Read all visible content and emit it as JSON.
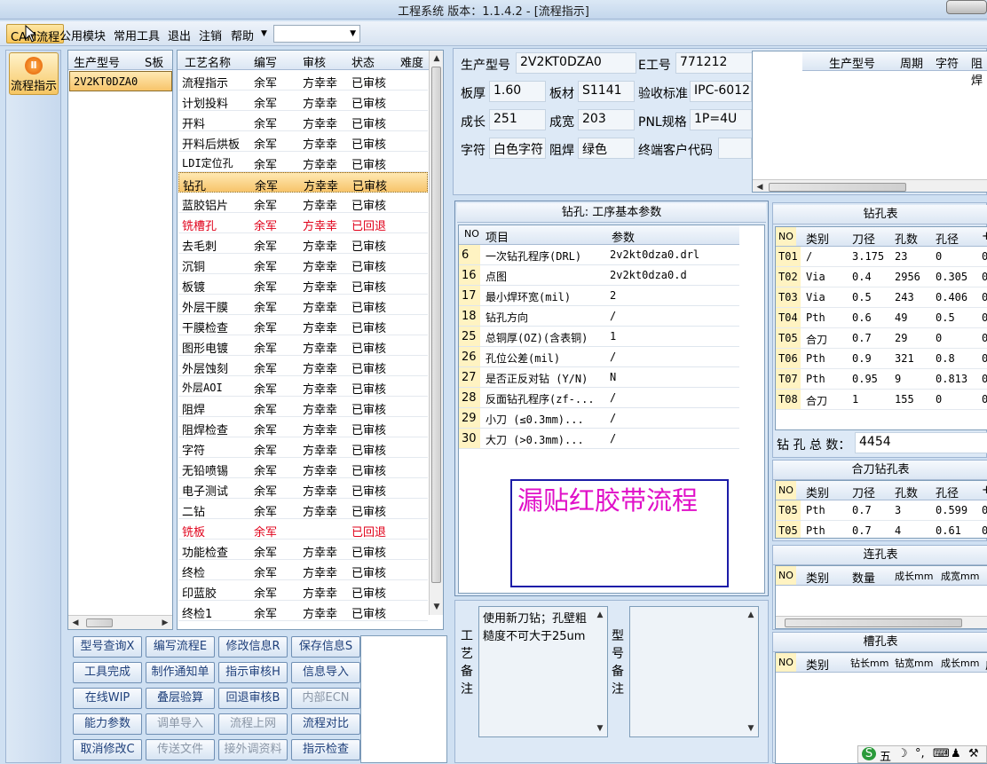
{
  "window": {
    "title": "工程系统   版本：1.1.4.2 - [流程指示]"
  },
  "menu": {
    "items": [
      {
        "label": "CAM流程",
        "active": true
      },
      {
        "label": "公用模块"
      },
      {
        "label": "常用工具"
      },
      {
        "label": "退出"
      },
      {
        "label": "注销"
      },
      {
        "label": "帮助"
      }
    ],
    "combo_value": ""
  },
  "nav": {
    "flow_button": "流程指示"
  },
  "models": {
    "headers": [
      "生产型号",
      "S板"
    ],
    "rows": [
      [
        "2V2KT0DZA0",
        ""
      ]
    ]
  },
  "process": {
    "headers": [
      "工艺名称",
      "编写",
      "审核",
      "状态",
      "难度"
    ],
    "selected_index": 5,
    "rows": [
      {
        "name": "流程指示",
        "writer": "余军",
        "reviewer": "方幸幸",
        "status": "已审核"
      },
      {
        "name": "计划投料",
        "writer": "余军",
        "reviewer": "方幸幸",
        "status": "已审核"
      },
      {
        "name": "开料",
        "writer": "余军",
        "reviewer": "方幸幸",
        "status": "已审核"
      },
      {
        "name": "开料后烘板",
        "writer": "余军",
        "reviewer": "方幸幸",
        "status": "已审核"
      },
      {
        "name": "LDI定位孔",
        "writer": "余军",
        "reviewer": "方幸幸",
        "status": "已审核"
      },
      {
        "name": "钻孔",
        "writer": "余军",
        "reviewer": "方幸幸",
        "status": "已审核"
      },
      {
        "name": "蓝胶铝片",
        "writer": "余军",
        "reviewer": "方幸幸",
        "status": "已审核"
      },
      {
        "name": "铣槽孔",
        "writer": "余军",
        "reviewer": "方幸幸",
        "status": "已回退",
        "red": true
      },
      {
        "name": "去毛刺",
        "writer": "余军",
        "reviewer": "方幸幸",
        "status": "已审核"
      },
      {
        "name": "沉铜",
        "writer": "余军",
        "reviewer": "方幸幸",
        "status": "已审核"
      },
      {
        "name": "板镀",
        "writer": "余军",
        "reviewer": "方幸幸",
        "status": "已审核"
      },
      {
        "name": "外层干膜",
        "writer": "余军",
        "reviewer": "方幸幸",
        "status": "已审核"
      },
      {
        "name": "干膜检查",
        "writer": "余军",
        "reviewer": "方幸幸",
        "status": "已审核"
      },
      {
        "name": "图形电镀",
        "writer": "余军",
        "reviewer": "方幸幸",
        "status": "已审核"
      },
      {
        "name": "外层蚀刻",
        "writer": "余军",
        "reviewer": "方幸幸",
        "status": "已审核"
      },
      {
        "name": "外层AOI",
        "writer": "余军",
        "reviewer": "方幸幸",
        "status": "已审核"
      },
      {
        "name": "阻焊",
        "writer": "余军",
        "reviewer": "方幸幸",
        "status": "已审核"
      },
      {
        "name": "阻焊检查",
        "writer": "余军",
        "reviewer": "方幸幸",
        "status": "已审核"
      },
      {
        "name": "字符",
        "writer": "余军",
        "reviewer": "方幸幸",
        "status": "已审核"
      },
      {
        "name": "无铅喷锡",
        "writer": "余军",
        "reviewer": "方幸幸",
        "status": "已审核"
      },
      {
        "name": "电子测试",
        "writer": "余军",
        "reviewer": "方幸幸",
        "status": "已审核"
      },
      {
        "name": "二钻",
        "writer": "余军",
        "reviewer": "方幸幸",
        "status": "已审核"
      },
      {
        "name": "铣板",
        "writer": "余军",
        "reviewer": "",
        "status": "已回退",
        "red": true
      },
      {
        "name": "功能检查",
        "writer": "余军",
        "reviewer": "方幸幸",
        "status": "已审核"
      },
      {
        "name": "终检",
        "writer": "余军",
        "reviewer": "方幸幸",
        "status": "已审核"
      },
      {
        "name": "印蓝胶",
        "writer": "余军",
        "reviewer": "方幸幸",
        "status": "已审核"
      },
      {
        "name": "终检1",
        "writer": "余军",
        "reviewer": "方幸幸",
        "status": "已审核"
      }
    ]
  },
  "buttons": [
    {
      "label": "型号查询X",
      "enabled": true
    },
    {
      "label": "编写流程E",
      "enabled": true
    },
    {
      "label": "修改信息R",
      "enabled": true
    },
    {
      "label": "保存信息S",
      "enabled": true
    },
    {
      "label": "工具完成",
      "enabled": true
    },
    {
      "label": "制作通知单",
      "enabled": true
    },
    {
      "label": "指示审核H",
      "enabled": true
    },
    {
      "label": "信息导入",
      "enabled": true
    },
    {
      "label": "在线WIP",
      "enabled": true
    },
    {
      "label": "叠层验算",
      "enabled": true
    },
    {
      "label": "回退审核B",
      "enabled": true
    },
    {
      "label": "内部ECN",
      "enabled": false
    },
    {
      "label": "能力参数",
      "enabled": true
    },
    {
      "label": "调单导入",
      "enabled": false
    },
    {
      "label": "流程上网",
      "enabled": false
    },
    {
      "label": "流程对比",
      "enabled": true
    },
    {
      "label": "取消修改C",
      "enabled": true
    },
    {
      "label": "传送文件",
      "enabled": false
    },
    {
      "label": "接外调资料",
      "enabled": false
    },
    {
      "label": "指示检查",
      "enabled": true
    }
  ],
  "info": {
    "model_label": "生产型号",
    "model_value": "2V2KT0DZA0",
    "eno_label": "E工号",
    "eno_value": "771212",
    "thickness_label": "板厚",
    "thickness_value": "1.60",
    "material_label": "板材",
    "material_value": "S1141",
    "standard_label": "验收标准",
    "standard_value": "IPC-6012",
    "length_label": "成长",
    "length_value": "251",
    "width_label": "成宽",
    "width_value": "203",
    "pnl_label": "PNL规格",
    "pnl_value": "1P=4U",
    "char_label": "字符",
    "char_value": "白色字符",
    "mask_label": "阻焊",
    "mask_value": "绿色",
    "customer_label": "终端客户代码",
    "customer_value": ""
  },
  "small_table": {
    "headers": [
      "生产型号",
      "周期",
      "字符",
      "阻焊"
    ]
  },
  "params": {
    "title": "钻孔: 工序基本参数",
    "headers": [
      "NO",
      "项目",
      "参数"
    ],
    "rows": [
      [
        "6",
        "一次钻孔程序(DRL)",
        "2v2kt0dza0.drl"
      ],
      [
        "16",
        "点图",
        "2v2kt0dza0.d"
      ],
      [
        "17",
        "最小焊环宽(mil)",
        "2"
      ],
      [
        "18",
        "钻孔方向",
        "/"
      ],
      [
        "25",
        "总铜厚(OZ)(含表铜)",
        "1"
      ],
      [
        "26",
        "孔位公差(mil)",
        "/"
      ],
      [
        "27",
        "是否正反对钻 (Y/N)",
        "N"
      ],
      [
        "28",
        "反面钻孔程序(zf-...",
        "/"
      ],
      [
        "29",
        "小刀 (≤0.3mm)...",
        "/"
      ],
      [
        "30",
        "大刀 (>0.3mm)...",
        "/"
      ]
    ],
    "note": "漏贴红胶带流程"
  },
  "drill": {
    "title": "钻孔表",
    "headers": [
      "NO",
      "类别",
      "刀径",
      "孔数",
      "孔径",
      "+"
    ],
    "rows": [
      [
        "T01",
        "/",
        "3.175",
        "23",
        "0",
        "0"
      ],
      [
        "T02",
        "Via",
        "0.4",
        "2956",
        "0.305",
        "0"
      ],
      [
        "T03",
        "Via",
        "0.5",
        "243",
        "0.406",
        "0"
      ],
      [
        "T04",
        "Pth",
        "0.6",
        "49",
        "0.5",
        "0"
      ],
      [
        "T05",
        "合刀",
        "0.7",
        "29",
        "0",
        "0"
      ],
      [
        "T06",
        "Pth",
        "0.9",
        "321",
        "0.8",
        "0"
      ],
      [
        "T07",
        "Pth",
        "0.95",
        "9",
        "0.813",
        "0"
      ],
      [
        "T08",
        "合刀",
        "1",
        "155",
        "0",
        "0"
      ]
    ],
    "total_label": "钻 孔 总 数：",
    "total_value": "4454"
  },
  "combo_drill": {
    "title": "合刀钻孔表",
    "headers": [
      "NO",
      "类别",
      "刀径",
      "孔数",
      "孔径",
      "+"
    ],
    "rows": [
      [
        "T05",
        "Pth",
        "0.7",
        "3",
        "0.599",
        "0"
      ],
      [
        "T05",
        "Pth",
        "0.7",
        "4",
        "0.61",
        "0"
      ]
    ]
  },
  "link_holes": {
    "title": "连孔表",
    "headers": [
      "NO",
      "类别",
      "数量",
      "成长mm",
      "成宽mm"
    ]
  },
  "slot_holes": {
    "title": "槽孔表",
    "headers": [
      "NO",
      "类别",
      "钻长mm",
      "钻宽mm",
      "成长mm",
      "成"
    ]
  },
  "remarks": {
    "process_label": "工艺备注",
    "process_text": "使用新刀钻；孔壁粗糙度不可大于25um",
    "model_label": "型号备注",
    "model_text": ""
  },
  "tray": {
    "items": [
      "S",
      "五",
      "☽",
      "°,",
      "⌨",
      "♟",
      "⚒"
    ]
  }
}
